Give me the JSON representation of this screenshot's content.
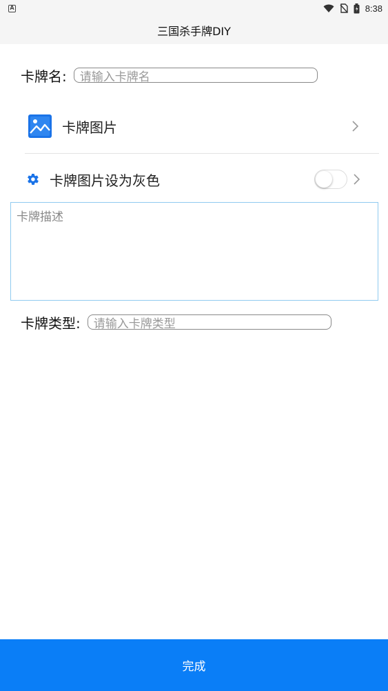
{
  "status_bar": {
    "app_icon_letter": "A",
    "time": "8:38",
    "icons": [
      "wifi-icon",
      "no-sim-icon",
      "battery-icon"
    ]
  },
  "app": {
    "title": "三国杀手牌DIY"
  },
  "form": {
    "name_label": "卡牌名:",
    "name_placeholder": "请输入卡牌名",
    "image_label": "卡牌图片",
    "gray_label": "卡牌图片设为灰色",
    "gray_enabled": false,
    "description_placeholder": "卡牌描述",
    "type_label": "卡牌类型:",
    "type_placeholder": "请输入卡牌类型"
  },
  "footer": {
    "done_label": "完成"
  },
  "colors": {
    "accent": "#0a7ef7",
    "icon_blue": "#1a73e8",
    "desc_border": "#8fcaf0",
    "bar_bg": "#f5f5f5"
  }
}
